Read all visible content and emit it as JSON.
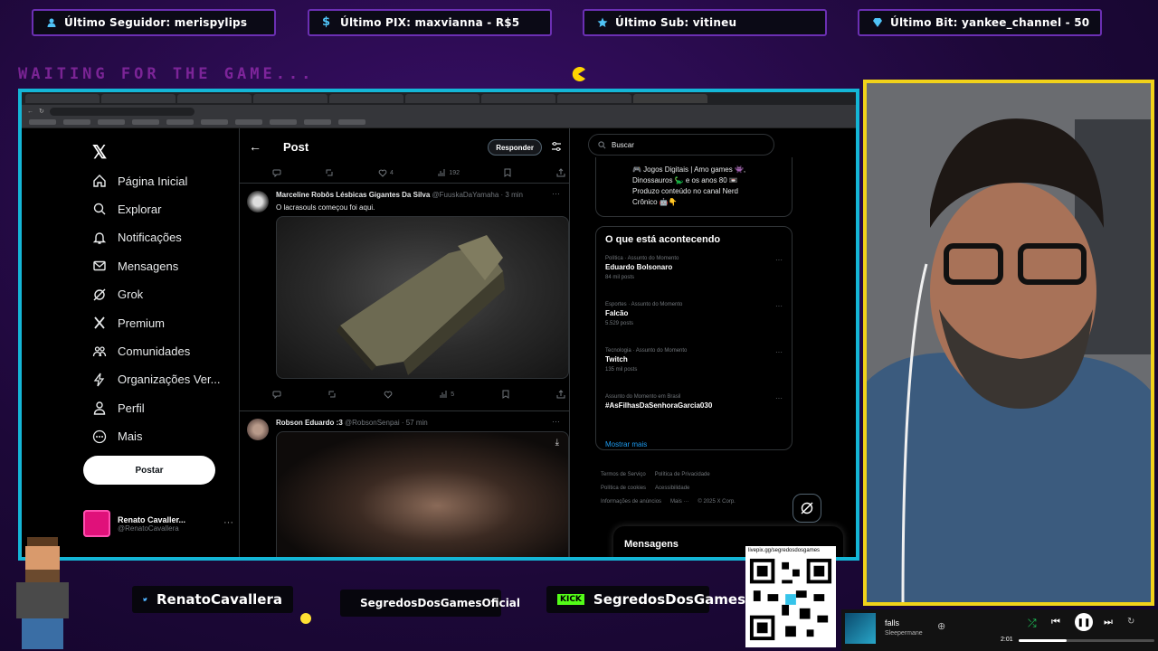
{
  "overlay": {
    "alerts": {
      "follower": "Último Seguidor: merispylips",
      "pix": "Último PIX: maxvianna - R$5",
      "sub": "Último Sub: vitineu",
      "bit": "Último Bit: yankee_channel - 50"
    },
    "waiting_text": "WAITING FOR THE GAME...",
    "socials": {
      "twitter": "RenatoCavallera",
      "instagram": "SegredosDosGamesOficial",
      "kick_badge": "KICK",
      "kick": "SegredosDosGames"
    },
    "qr_url": "livepix.gg/segredosdosgames",
    "colors": {
      "frame_cyan": "#14b6d6",
      "webcam_yellow": "#f1d21a",
      "purple": "#6b2fb3"
    }
  },
  "x_app": {
    "nav": [
      {
        "label": "Página Inicial",
        "icon": "home-icon"
      },
      {
        "label": "Explorar",
        "icon": "search-icon"
      },
      {
        "label": "Notificações",
        "icon": "bell-icon"
      },
      {
        "label": "Mensagens",
        "icon": "mail-icon"
      },
      {
        "label": "Grok",
        "icon": "grok-icon"
      },
      {
        "label": "Premium",
        "icon": "x-icon"
      },
      {
        "label": "Comunidades",
        "icon": "people-icon"
      },
      {
        "label": "Organizações Ver...",
        "icon": "lightning-icon"
      },
      {
        "label": "Perfil",
        "icon": "person-icon"
      },
      {
        "label": "Mais",
        "icon": "more-circle-icon"
      }
    ],
    "post_button": "Postar",
    "account": {
      "name": "Renato Cavaller...",
      "handle": "@RenatoCavallera"
    },
    "header": {
      "title": "Post",
      "reply_button": "Responder"
    },
    "top_actions": {
      "likes": "4",
      "views": "192"
    },
    "tweets": [
      {
        "name": "Marceline Robôs Lésbicas Gigantes Da Silva",
        "handle": "@FuuskaDaYamaha · 3 min",
        "text": "O lacrasouls começou foi aqui.",
        "views": "5"
      },
      {
        "name": "Robson Eduardo :3",
        "handle": "@RobsonSenpai · 57 min",
        "text": ""
      }
    ],
    "search": {
      "placeholder": "Buscar"
    },
    "bio": {
      "line1": "🎮 Jogos Digitais | Amo games 👾,",
      "line2": "Dinossauros 🦕 e os anos 80 📼",
      "line3": "Produzo conteúdo no canal Nerd",
      "line4": "Crônico 🤖👇"
    },
    "trends_title": "O que está acontecendo",
    "trends": [
      {
        "context": "Política · Assunto do Momento",
        "name": "Eduardo Bolsonaro",
        "count": "84 mil posts"
      },
      {
        "context": "Esportes · Assunto do Momento",
        "name": "Falcão",
        "count": "5.529 posts"
      },
      {
        "context": "Tecnologia · Assunto do Momento",
        "name": "Twitch",
        "count": "135 mil posts"
      },
      {
        "context": "Assunto do Momento em Brasil",
        "name": "#AsFilhasDaSenhoraGarcia030",
        "count": ""
      }
    ],
    "show_more": "Mostrar mais",
    "footer": {
      "terms": "Termos de Serviço",
      "privacy": "Política de Privacidade",
      "cookies": "Política de cookies",
      "access": "Acessibilidade",
      "ads": "Informações de anúncios",
      "more": "Mais ···",
      "copy": "© 2025 X Corp."
    },
    "messages_drawer": "Mensagens"
  },
  "spotify": {
    "title": "falls",
    "artist": "Sleepermane",
    "elapsed": "2:01",
    "progress": 0.35
  }
}
